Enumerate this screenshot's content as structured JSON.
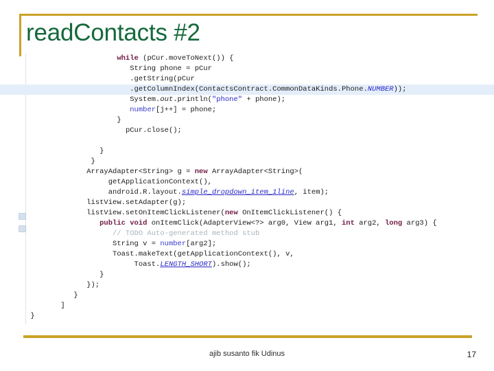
{
  "slide": {
    "title": "readContacts #2",
    "accent_gold": "#c9a227",
    "title_green": "#14683a",
    "highlight_blue": "#e4eefb",
    "background": "#ffffff"
  },
  "footer": {
    "center_text": "ajib susanto fik Udinus",
    "page_number": "17"
  },
  "code": {
    "language": "java",
    "highlighted_line_index": 3,
    "lines": [
      {
        "indent": 21,
        "plain": "while (pCur.moveToNext()) {",
        "tokens": [
          {
            "t": "while",
            "c": "kw"
          },
          {
            "t": " (pCur.moveToNext()) {",
            "c": "pln"
          }
        ]
      },
      {
        "indent": 24,
        "plain": "String phone = pCur",
        "tokens": [
          {
            "t": "String phone = pCur",
            "c": "pln"
          }
        ]
      },
      {
        "indent": 24,
        "plain": ".getString(pCur",
        "tokens": [
          {
            "t": ".getString(pCur",
            "c": "pln"
          }
        ]
      },
      {
        "indent": 24,
        "plain": ".getColumnIndex(ContactsContract.CommonDataKinds.Phone.NUMBER));",
        "tokens": [
          {
            "t": ".getColumnIndex(ContactsContract.CommonDataKinds.Phone.",
            "c": "pln"
          },
          {
            "t": "NUMBER",
            "c": "sfld-nb"
          },
          {
            "t": "));",
            "c": "pln"
          }
        ]
      },
      {
        "indent": 24,
        "plain": "System.out.println(\"phone\" + phone);",
        "tokens": [
          {
            "t": "System.",
            "c": "pln"
          },
          {
            "t": "out",
            "c": "fld"
          },
          {
            "t": ".println(",
            "c": "pln"
          },
          {
            "t": "\"phone\"",
            "c": "str"
          },
          {
            "t": " + phone);",
            "c": "pln"
          }
        ]
      },
      {
        "indent": 24,
        "plain": "number[j++] = phone;",
        "tokens": [
          {
            "t": "number",
            "c": "num"
          },
          {
            "t": "[j++] = phone;",
            "c": "pln"
          }
        ]
      },
      {
        "indent": 21,
        "plain": "}",
        "tokens": [
          {
            "t": "}",
            "c": "pln"
          }
        ]
      },
      {
        "indent": 23,
        "plain": "pCur.close();",
        "tokens": [
          {
            "t": "pCur.close();",
            "c": "pln"
          }
        ]
      },
      {
        "indent": 0,
        "plain": "",
        "tokens": []
      },
      {
        "indent": 17,
        "plain": "}",
        "tokens": [
          {
            "t": "}",
            "c": "pln"
          }
        ]
      },
      {
        "indent": 15,
        "plain": "}",
        "tokens": [
          {
            "t": "}",
            "c": "pln"
          }
        ]
      },
      {
        "indent": 14,
        "plain": "ArrayAdapter<String> g = new ArrayAdapter<String>(",
        "tokens": [
          {
            "t": "ArrayAdapter<String> g = ",
            "c": "pln"
          },
          {
            "t": "new",
            "c": "kw"
          },
          {
            "t": " ArrayAdapter<String>(",
            "c": "pln"
          }
        ]
      },
      {
        "indent": 19,
        "plain": "getApplicationContext(),",
        "tokens": [
          {
            "t": "getApplicationContext(),",
            "c": "pln"
          }
        ]
      },
      {
        "indent": 19,
        "plain": "android.R.layout.simple_dropdown_item_1line, item);",
        "tokens": [
          {
            "t": "android.R.layout.",
            "c": "pln"
          },
          {
            "t": "simple_dropdown_item_1line",
            "c": "sfld"
          },
          {
            "t": ", item);",
            "c": "pln"
          }
        ]
      },
      {
        "indent": 14,
        "plain": "listView.setAdapter(g);",
        "tokens": [
          {
            "t": "listView.setAdapter(g);",
            "c": "pln"
          }
        ]
      },
      {
        "indent": 14,
        "plain": "listView.setOnItemClickListener(new OnItemClickListener() {",
        "tokens": [
          {
            "t": "listView.setOnItemClickListener(",
            "c": "pln"
          },
          {
            "t": "new",
            "c": "kw"
          },
          {
            "t": " OnItemClickListener() {",
            "c": "pln"
          }
        ]
      },
      {
        "indent": 17,
        "plain": "public void onItemClick(AdapterView<?> arg0, View arg1, int arg2, long arg3) {",
        "tokens": [
          {
            "t": "public void",
            "c": "kw"
          },
          {
            "t": " onItemClick(AdapterView<?> arg0, View arg1, ",
            "c": "pln"
          },
          {
            "t": "int",
            "c": "kw"
          },
          {
            "t": " arg2, ",
            "c": "pln"
          },
          {
            "t": "long",
            "c": "kw"
          },
          {
            "t": " arg3) {",
            "c": "pln"
          }
        ]
      },
      {
        "indent": 20,
        "plain": "// TODO Auto-generated method stub",
        "tokens": [
          {
            "t": "// TODO Auto-generated method stub",
            "c": "cmt"
          }
        ]
      },
      {
        "indent": 20,
        "plain": "String v = number[arg2];",
        "tokens": [
          {
            "t": "String v = ",
            "c": "pln"
          },
          {
            "t": "number",
            "c": "num"
          },
          {
            "t": "[arg2];",
            "c": "pln"
          }
        ]
      },
      {
        "indent": 20,
        "plain": "Toast.makeText(getApplicationContext(), v,",
        "tokens": [
          {
            "t": "Toast.makeText(getApplicationContext(), v,",
            "c": "pln"
          }
        ]
      },
      {
        "indent": 25,
        "plain": "Toast.LENGTH_SHORT).show();",
        "tokens": [
          {
            "t": "Toast.",
            "c": "pln"
          },
          {
            "t": "LENGTH_SHORT",
            "c": "sfld"
          },
          {
            "t": ").show();",
            "c": "pln"
          }
        ]
      },
      {
        "indent": 17,
        "plain": "}",
        "tokens": [
          {
            "t": "}",
            "c": "pln"
          }
        ]
      },
      {
        "indent": 14,
        "plain": "});",
        "tokens": [
          {
            "t": "});",
            "c": "pln"
          }
        ]
      },
      {
        "indent": 11,
        "plain": "}",
        "tokens": [
          {
            "t": "}",
            "c": "pln"
          }
        ]
      },
      {
        "indent": 8,
        "plain": "]",
        "tokens": [
          {
            "t": "]",
            "c": "pln"
          }
        ]
      },
      {
        "indent": 1,
        "plain": "}",
        "tokens": [
          {
            "t": "}",
            "c": "pln"
          }
        ]
      }
    ]
  }
}
